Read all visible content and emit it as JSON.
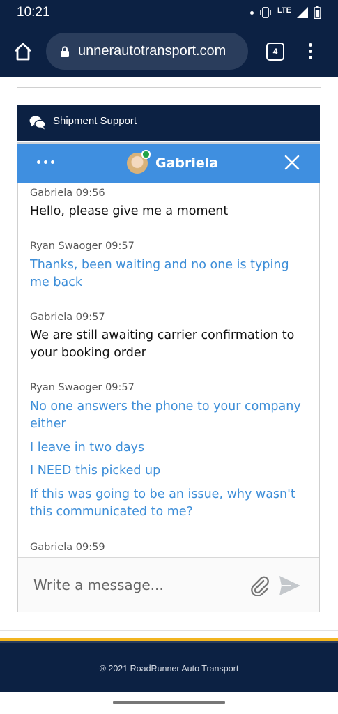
{
  "status_bar": {
    "time": "10:21",
    "network": "LTE"
  },
  "browser": {
    "url": "unnerautotransport.com",
    "tab_count": "4"
  },
  "support_header": {
    "title": "Shipment Support"
  },
  "chat": {
    "agent_name": "Gabriela",
    "messages": [
      {
        "meta": "Gabriela 09:56",
        "lines": [
          "Hello, please give me a moment"
        ]
      },
      {
        "meta": "Ryan Swaoger 09:57",
        "lines": [
          "Thanks, been waiting and no one is typing me back"
        ]
      },
      {
        "meta": "Gabriela 09:57",
        "lines": [
          "We are still awaiting carrier confirmation to your booking order"
        ]
      },
      {
        "meta": "Ryan Swaoger 09:57",
        "lines": [
          "No one answers the phone to your company either",
          "I leave in two days",
          "I NEED this picked up",
          "If this was going to be an issue, why wasn't this communicated to me?"
        ]
      },
      {
        "meta": "Gabriela 09:59",
        "lines": []
      }
    ],
    "input_placeholder": "Write a message..."
  },
  "footer": {
    "copyright": "® 2021 RoadRunner Auto Transport"
  },
  "colors": {
    "navy": "#0c2143",
    "chat_header": "#3f8fe0",
    "visitor_text": "#3d8ed8",
    "accent_stripe": "#f2b51f"
  }
}
